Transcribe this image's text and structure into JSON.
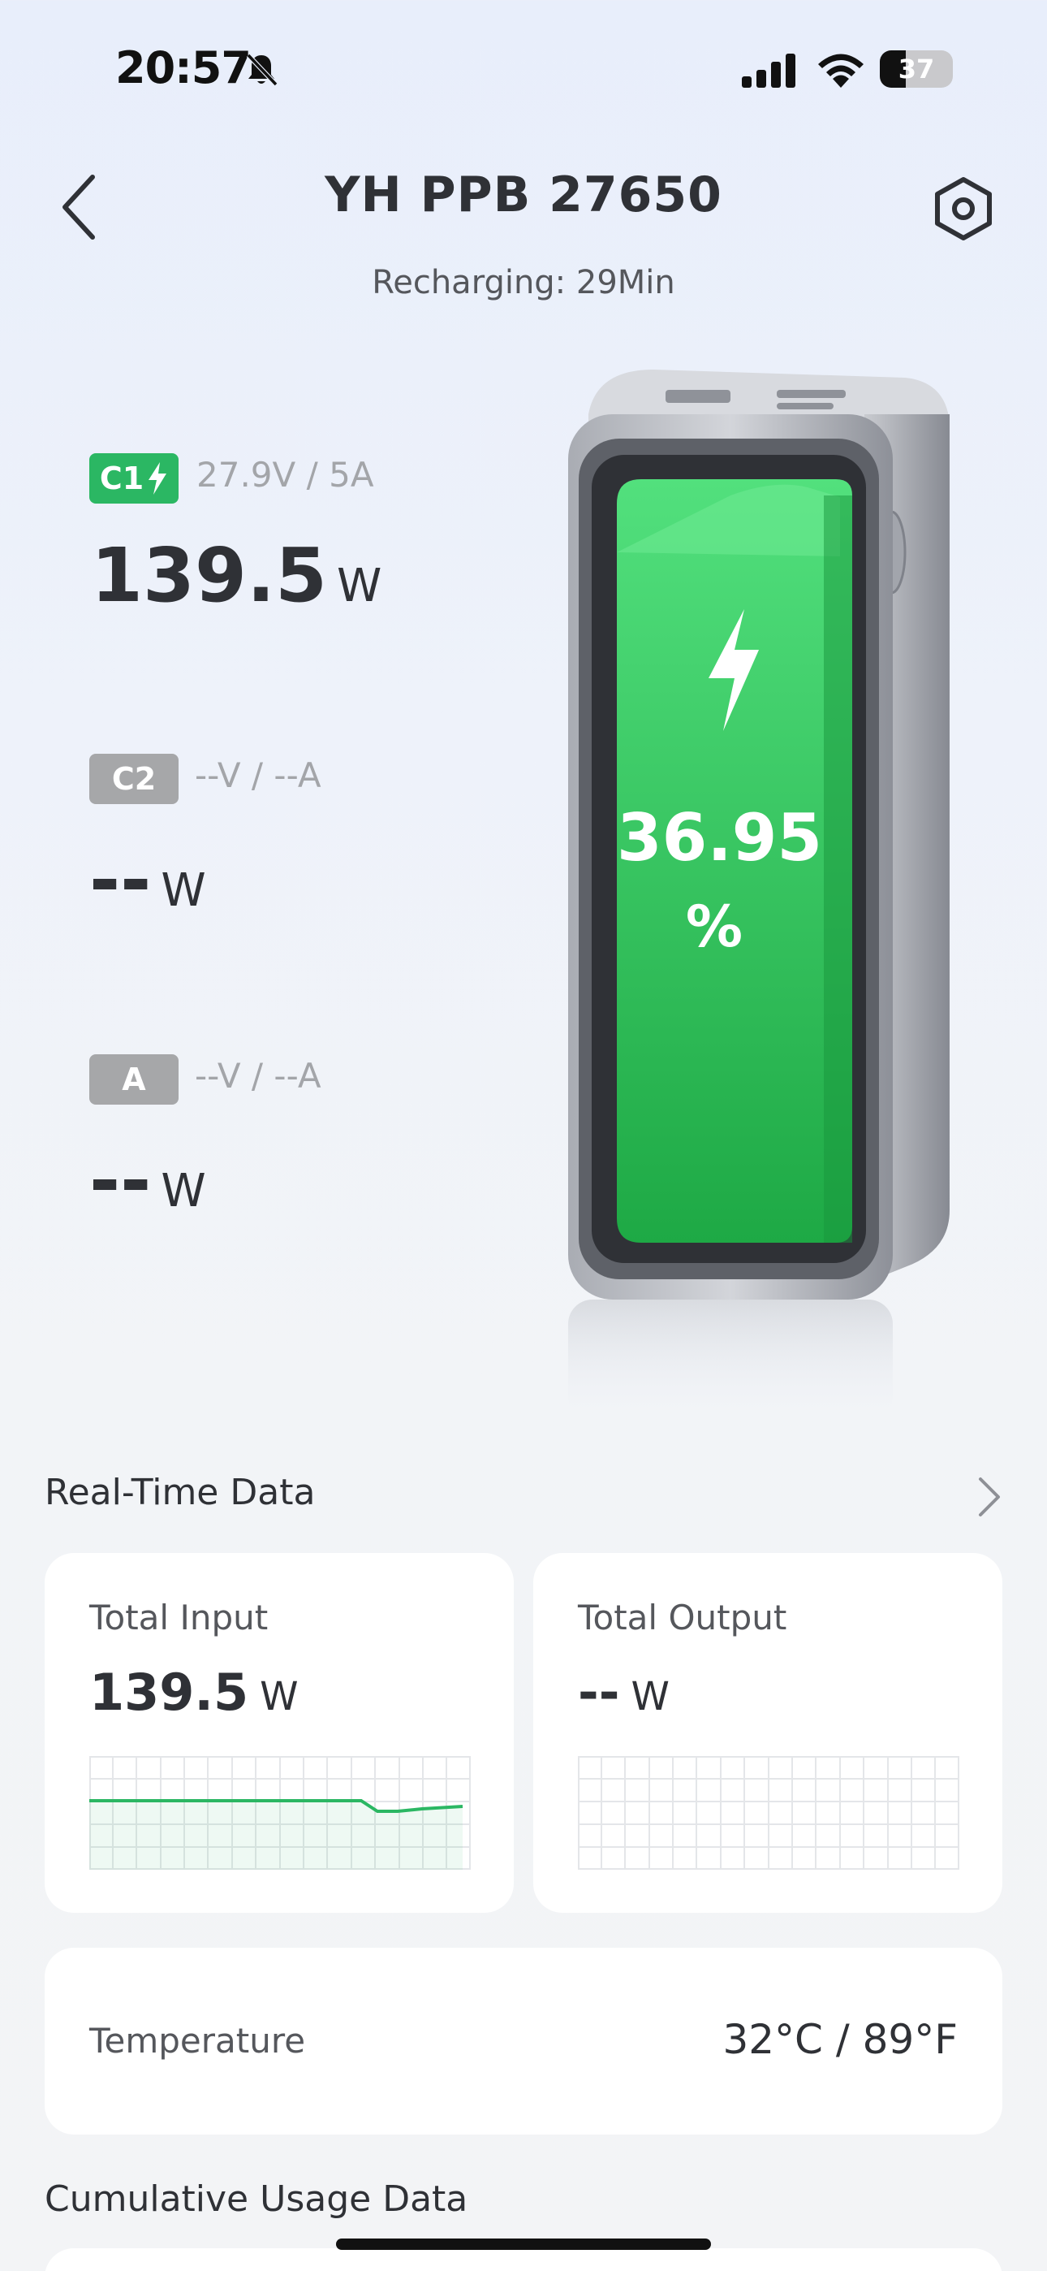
{
  "status_bar": {
    "time": "20:57",
    "battery_level": "37"
  },
  "header": {
    "title": "YH PPB 27650",
    "subtitle": "Recharging: 29Min"
  },
  "ports": [
    {
      "badge": "C1",
      "charging": true,
      "voltage_current": "27.9V / 5A",
      "power_value": "139.5",
      "power_unit": "W",
      "badge_color": "#2bb763"
    },
    {
      "badge": "C2",
      "charging": false,
      "voltage_current": "--V / --A",
      "power_value": "--",
      "power_unit": "W",
      "badge_color": "#a6a7a9"
    },
    {
      "badge": "A",
      "charging": false,
      "voltage_current": "--V / --A",
      "power_value": "--",
      "power_unit": "W",
      "badge_color": "#a6a7a9"
    }
  ],
  "battery": {
    "percent_value": "36.95",
    "percent_unit": "%",
    "level": 36.95,
    "color": "#2fc765"
  },
  "realtime": {
    "section_title": "Real-Time Data",
    "total_input": {
      "label": "Total Input",
      "value": "139.5",
      "unit": "W"
    },
    "total_output": {
      "label": "Total Output",
      "value": "--",
      "unit": "W"
    }
  },
  "temperature": {
    "label": "Temperature",
    "value": "32°C / 89°F"
  },
  "cumulative": {
    "section_title": "Cumulative Usage Data"
  },
  "accent_color": "#2bb763"
}
